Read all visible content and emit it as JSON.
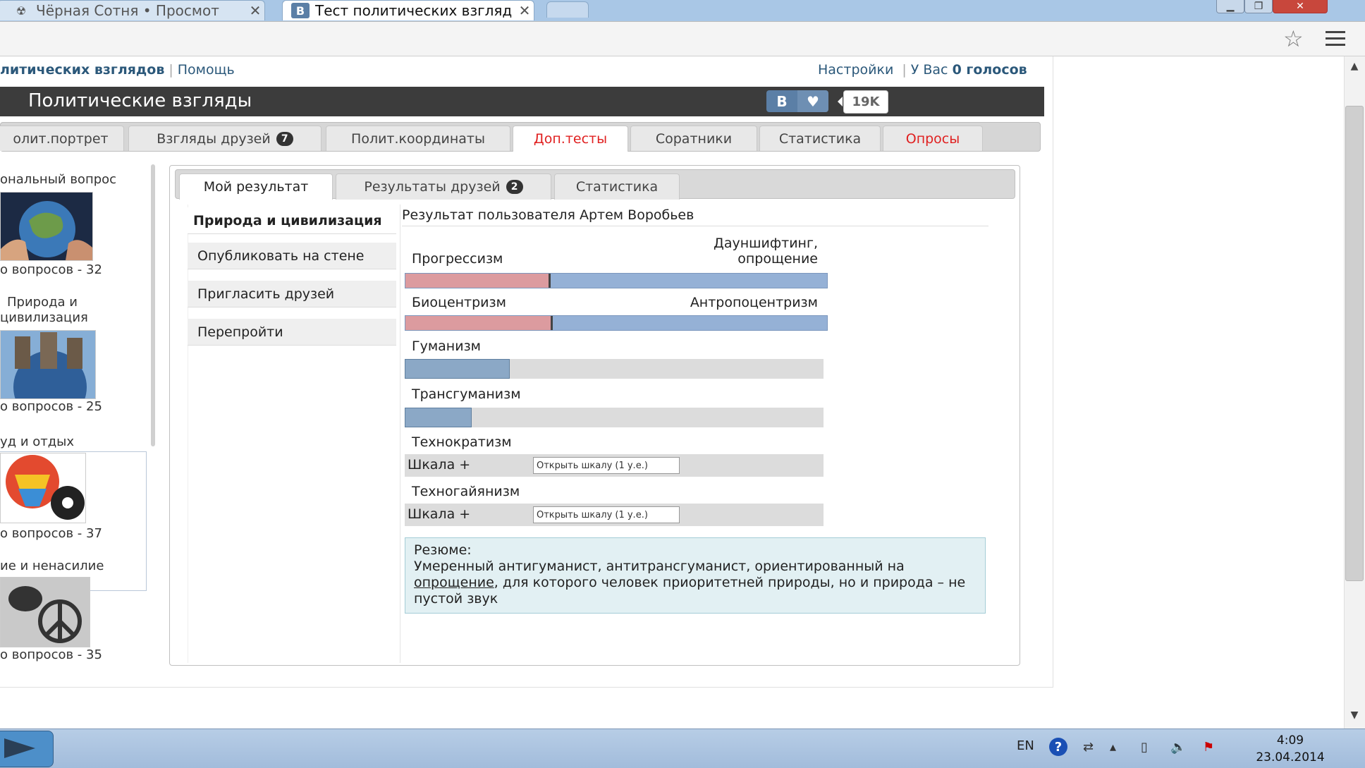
{
  "browser": {
    "tabs": [
      {
        "title": "Чёрная Сотня • Просмот",
        "icon": "radiation-icon",
        "active": false
      },
      {
        "title": "Тест политических взгляд",
        "icon": "vk-icon",
        "icon_text": "В",
        "active": true
      }
    ],
    "close_glyph": "✕"
  },
  "app": {
    "nav_links": {
      "app_name": "литических взглядов",
      "help": "Помощь"
    },
    "settings": "Настройки",
    "votes_prefix": "У Вас",
    "votes_count": "0 голосов",
    "header_title": "Политические взгляды",
    "vk_share": "В",
    "like_count": "19K"
  },
  "main_tabs": [
    {
      "label": "олит.портрет"
    },
    {
      "label": "Взгляды друзей",
      "badge": "7"
    },
    {
      "label": "Полит.координаты"
    },
    {
      "label": "Доп.тесты",
      "active": true
    },
    {
      "label": "Соратники"
    },
    {
      "label": "Статистика"
    },
    {
      "label": "Опросы",
      "red": true
    }
  ],
  "left_list": [
    {
      "title": "ональный вопрос",
      "count": "о вопросов - 32"
    },
    {
      "title_line1": "Природа и",
      "title_line2": "цивилизация",
      "count": "о вопросов - 25"
    },
    {
      "title": "уд и отдых",
      "count": "о вопросов - 37"
    },
    {
      "title": "ие и ненасилие",
      "count": "о вопросов - 35"
    }
  ],
  "sub_tabs": [
    {
      "label": "Мой результат",
      "active": true
    },
    {
      "label": "Результаты друзей",
      "badge": "2"
    },
    {
      "label": "Статистика"
    }
  ],
  "side_menu": [
    {
      "label": "Природа и цивилизация",
      "active": true
    },
    {
      "label": "Опубликовать на стене"
    },
    {
      "label": "Пригласить друзей"
    },
    {
      "label": "Перепройти"
    }
  ],
  "result": {
    "title": "Результат пользователя Артем Воробьев",
    "scales": [
      {
        "left": "Прогрессизм",
        "right_line1": "Дауншифтинг,",
        "right_line2": "опрощение",
        "position": 0.34
      },
      {
        "left": "Биоцентризм",
        "right": "Антропоцентризм",
        "position": 0.345
      }
    ],
    "bars": [
      {
        "label": "Гуманизм",
        "value": 0.25
      },
      {
        "label": "Трансгуманизм",
        "value": 0.16
      }
    ],
    "locked": [
      {
        "label": "Технократизм",
        "scale_text": "Шкала +",
        "button": "Открыть шкалу (1 у.е.)"
      },
      {
        "label": "Техногайянизм",
        "scale_text": "Шкала +",
        "button": "Открыть шкалу (1 у.е.)"
      }
    ],
    "resume": {
      "heading": "Резюме:",
      "text_before": "Умеренный антигуманист, антитрансгуманист, ориентированный на",
      "link": "опрощение",
      "text_after": ", для которого человек приоритетней природы, но и природа – не пустой звук"
    }
  },
  "taskbar": {
    "lang": "EN",
    "time": "4:09",
    "date": "23.04.2014"
  },
  "colors": {
    "header_bg": "#3c3c3c",
    "accent_red": "#e02020",
    "scale_left": "#dc9b9f",
    "scale_right": "#95b1d6",
    "link": "#2b587a"
  }
}
